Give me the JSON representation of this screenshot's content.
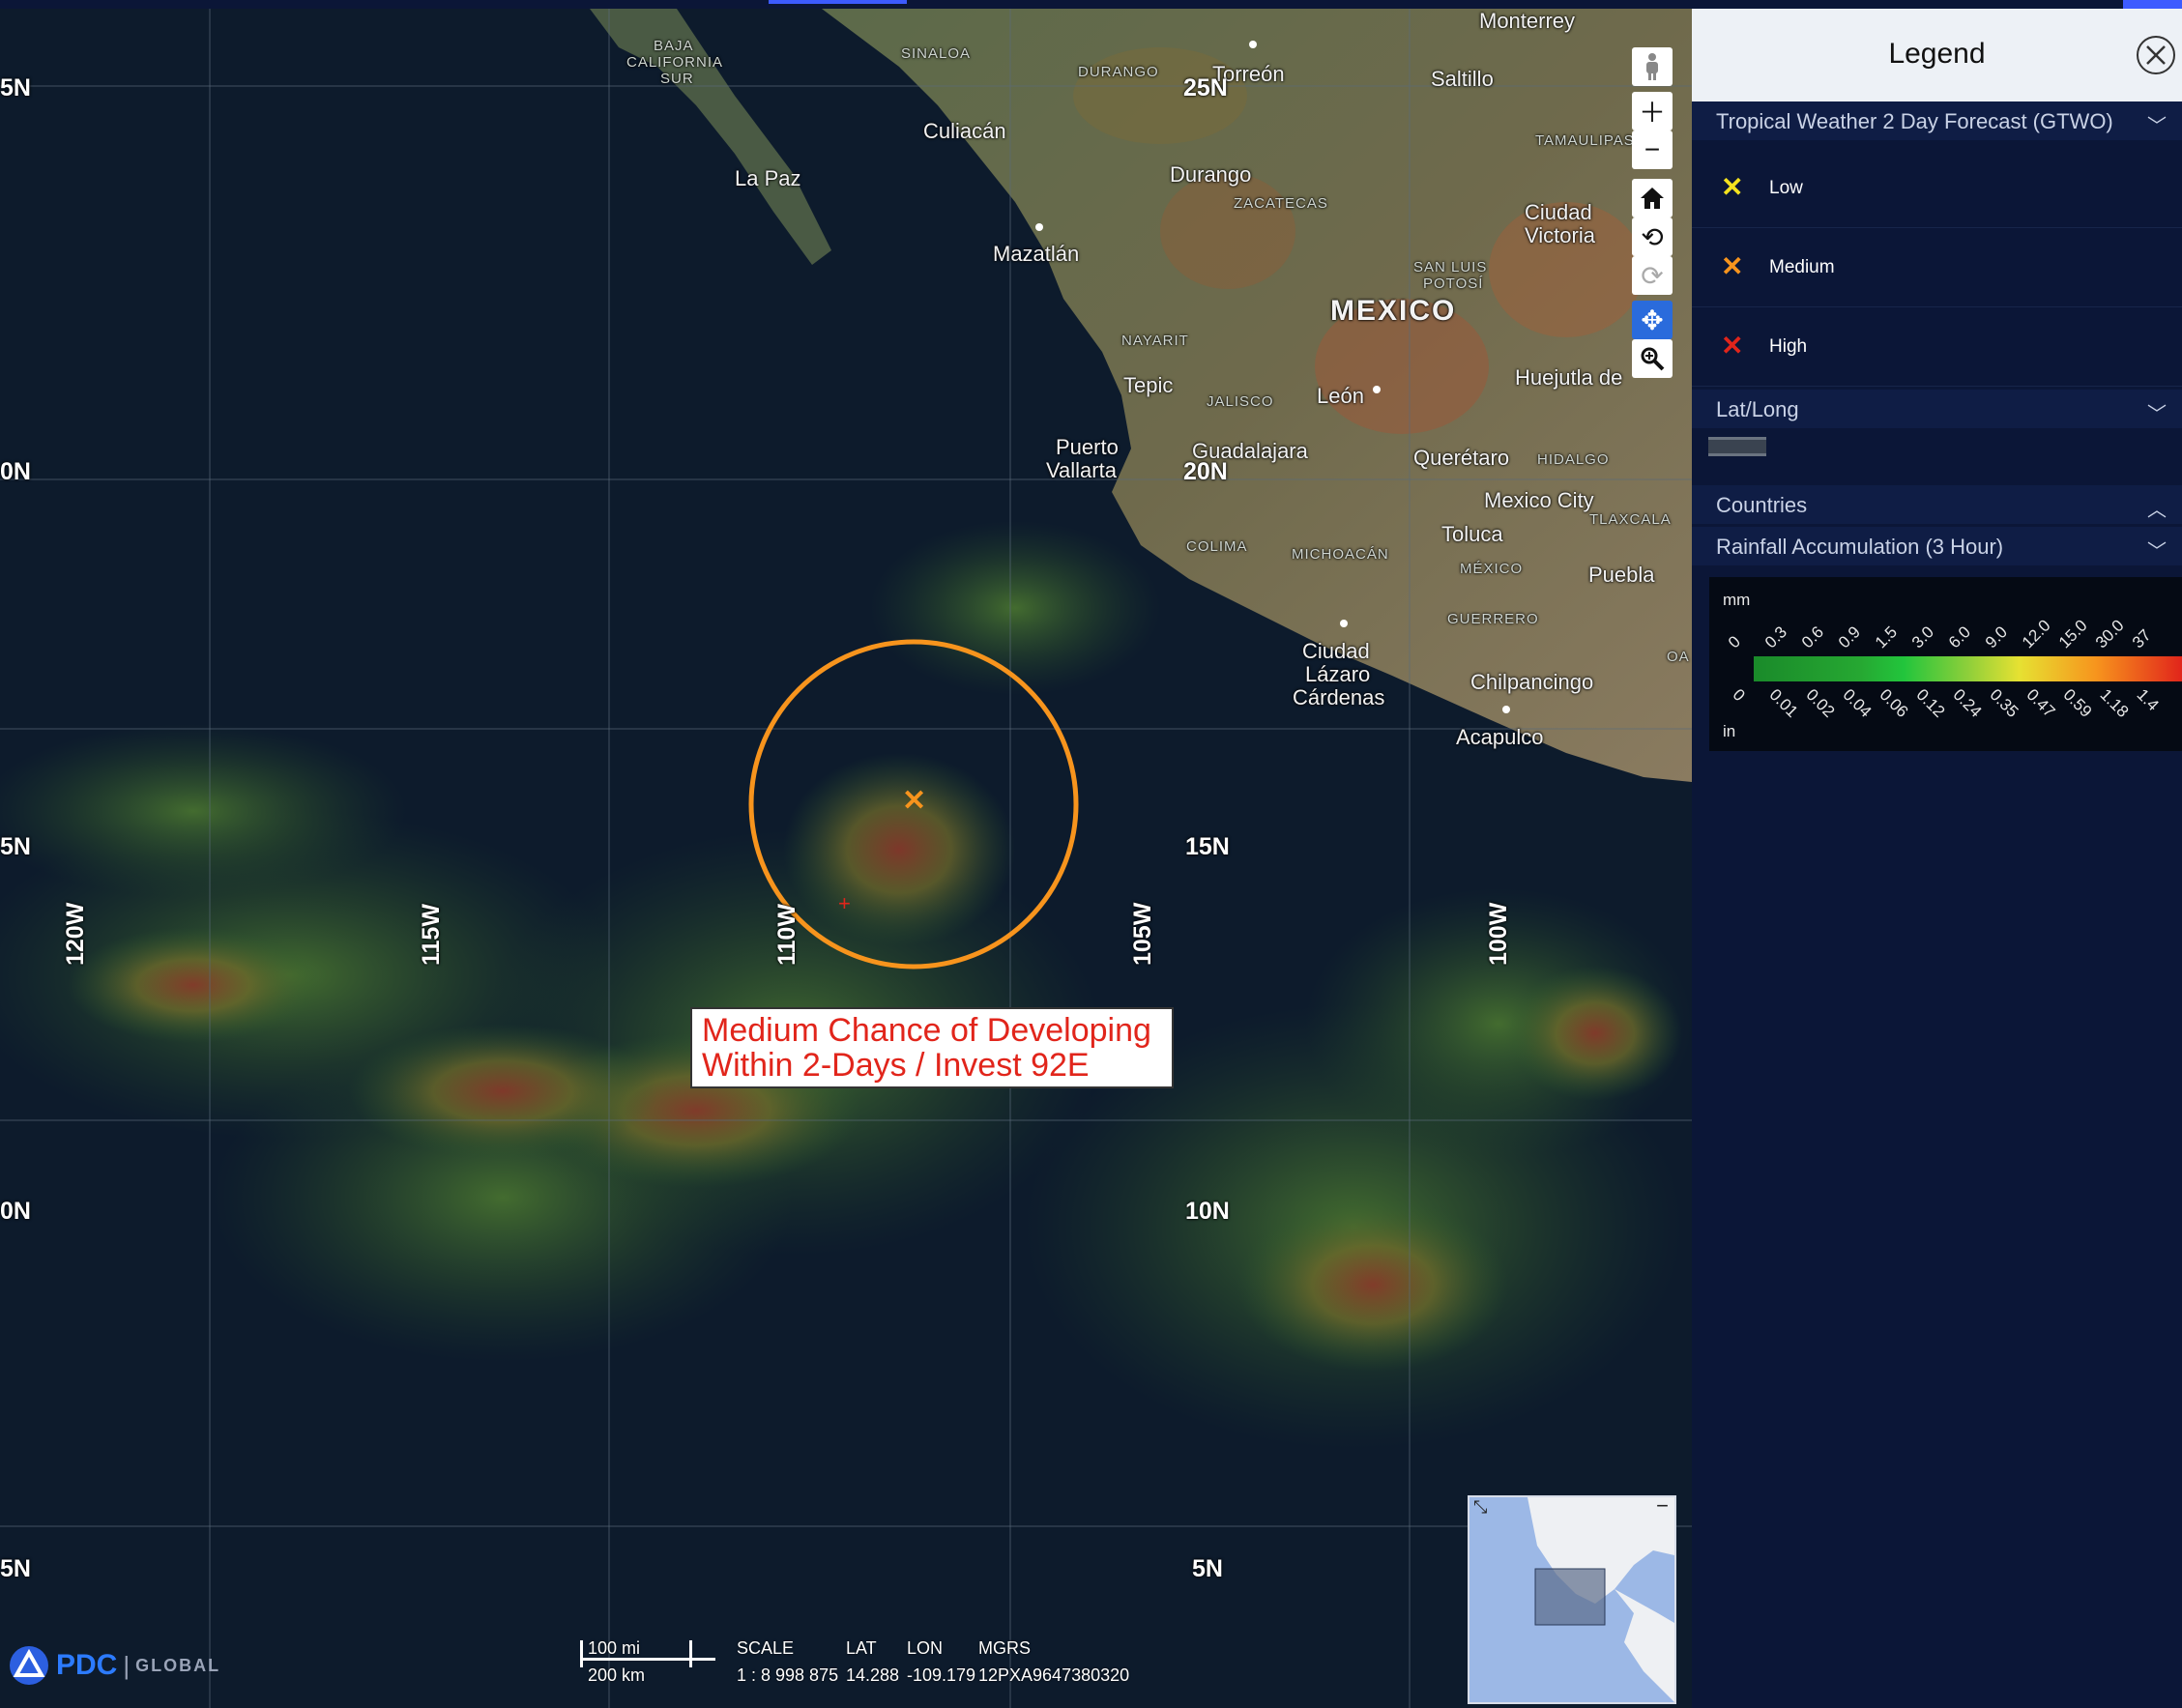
{
  "map": {
    "callout": {
      "line1": "Medium Chance of Developing",
      "line2": "Within 2-Days / Invest 92E"
    },
    "lat_labels": [
      "25N",
      "20N",
      "15N",
      "10N",
      "5N"
    ],
    "lat_labels_left": [
      "5N",
      "0N",
      "5N",
      "0N",
      "5N"
    ],
    "lon_labels": [
      "120W",
      "115W",
      "110W",
      "105W",
      "100W"
    ],
    "country_label": "MEXICO",
    "cities": {
      "monterrey": "Monterrey",
      "saltillo": "Saltillo",
      "torreon": "Torreón",
      "culiacan": "Culiacán",
      "la_paz": "La Paz",
      "durango": "Durango",
      "mazatlan": "Mazatlán",
      "ciudad_victoria": "Ciudad\nVictoria",
      "tepic": "Tepic",
      "leon": "León",
      "huejutla": "Huejutla de",
      "puerto_vallarta_1": "Puerto",
      "puerto_vallarta_2": "Vallarta",
      "guadalajara": "Guadalajara",
      "queretaro": "Querétaro",
      "mexico_city": "Mexico City",
      "toluca": "Toluca",
      "puebla": "Puebla",
      "lazaro_1": "Ciudad",
      "lazaro_2": "Lázaro",
      "lazaro_3": "Cárdenas",
      "chilpancingo": "Chilpancingo",
      "acapulco": "Acapulco"
    },
    "states": {
      "baja_1": "BAJA",
      "baja_2": "CALIFORNIA",
      "baja_3": "SUR",
      "sinaloa": "SINALOA",
      "durango": "DURANGO",
      "tamaulipas": "TAMAULIPAS",
      "zacatecas": "ZACATECAS",
      "slp_1": "SAN LUIS",
      "slp_2": "POTOSÍ",
      "nayarit": "NAYARIT",
      "jalisco": "JALISCO",
      "hidalgo": "HIDALGO",
      "tlaxcala": "TLAXCALA",
      "colima": "COLIMA",
      "michoacan": "MICHOACÁN",
      "mexico": "MÉXICO",
      "guerrero": "GUERRERO",
      "oa": "OA"
    },
    "marker": {
      "category": "Medium",
      "color": "#f7941d"
    },
    "scale_bar": {
      "miles": "100 mi",
      "km": "200 km",
      "scale_label": "SCALE",
      "scale_value": "1 : 8 998 875",
      "lat_label": "LAT",
      "lat_value": "14.288",
      "lon_label": "LON",
      "lon_value": "-109.179",
      "mgrs_label": "MGRS",
      "mgrs_value": "12PXA9647380320"
    },
    "logo": {
      "brand": "PDC",
      "tag": "GLOBAL"
    },
    "toolbar_icons": [
      "street-view-icon",
      "zoom-in-icon",
      "zoom-out-icon",
      "home-icon",
      "rotate-left-icon",
      "rotate-right-icon",
      "pan-icon",
      "zoom-box-icon"
    ]
  },
  "legend": {
    "title": "Legend",
    "sections": {
      "gtwo": "Tropical Weather 2 Day Forecast (GTWO)",
      "latlong": "Lat/Long",
      "countries": "Countries",
      "rainfall": "Rainfall Accumulation (3 Hour)"
    },
    "gtwo_items": [
      {
        "label": "Low",
        "color": "#f4e21e"
      },
      {
        "label": "Medium",
        "color": "#f7941d"
      },
      {
        "label": "High",
        "color": "#e1251b"
      }
    ],
    "rainfall": {
      "unit_top": "mm",
      "unit_bottom": "in",
      "mm_values": [
        "0",
        "0.3",
        "0.6",
        "0.9",
        "1.5",
        "3.0",
        "6.0",
        "9.0",
        "12.0",
        "15.0",
        "30.0",
        "37"
      ],
      "in_values": [
        "0",
        "0.01",
        "0.02",
        "0.04",
        "0.06",
        "0.12",
        "0.24",
        "0.35",
        "0.47",
        "0.59",
        "1.18",
        "1.4"
      ]
    }
  }
}
